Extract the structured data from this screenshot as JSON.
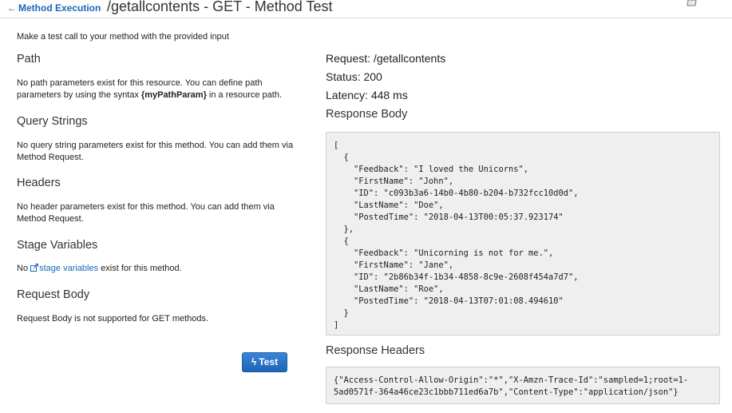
{
  "header": {
    "back_label": "Method Execution",
    "title": "/getallcontents - GET - Method Test"
  },
  "left": {
    "intro": "Make a test call to your method with the provided input",
    "path": {
      "title": "Path",
      "text_before": "No path parameters exist for this resource. You can define path parameters by using the syntax ",
      "syntax": "{myPathParam}",
      "text_after": " in a resource path."
    },
    "query_strings": {
      "title": "Query Strings",
      "text": "No query string parameters exist for this method. You can add them via Method Request."
    },
    "headers": {
      "title": "Headers",
      "text": "No header parameters exist for this method. You can add them via Method Request."
    },
    "stage_variables": {
      "title": "Stage Variables",
      "text_before": "No ",
      "link": "stage variables",
      "text_after": " exist for this method."
    },
    "request_body": {
      "title": "Request Body",
      "text": "Request Body is not supported for GET methods."
    },
    "test_button": "Test"
  },
  "right": {
    "request": "Request: /getallcontents",
    "status": "Status: 200",
    "latency": "Latency: 448 ms",
    "response_body_title": "Response Body",
    "response_body": "[\n  {\n    \"Feedback\": \"I loved the Unicorns\",\n    \"FirstName\": \"John\",\n    \"ID\": \"c093b3a6-14b0-4b80-b204-b732fcc10d0d\",\n    \"LastName\": \"Doe\",\n    \"PostedTime\": \"2018-04-13T00:05:37.923174\"\n  },\n  {\n    \"Feedback\": \"Unicorning is not for me.\",\n    \"FirstName\": \"Jane\",\n    \"ID\": \"2b86b34f-1b34-4858-8c9e-2608f454a7d7\",\n    \"LastName\": \"Roe\",\n    \"PostedTime\": \"2018-04-13T07:01:08.494610\"\n  }\n]",
    "response_headers_title": "Response Headers",
    "response_headers": "{\"Access-Control-Allow-Origin\":\"*\",\"X-Amzn-Trace-Id\":\"sampled=1;root=1-\n5ad0571f-364a46ce23c1bbb711ed6a7b\",\"Content-Type\":\"application/json\"}"
  }
}
